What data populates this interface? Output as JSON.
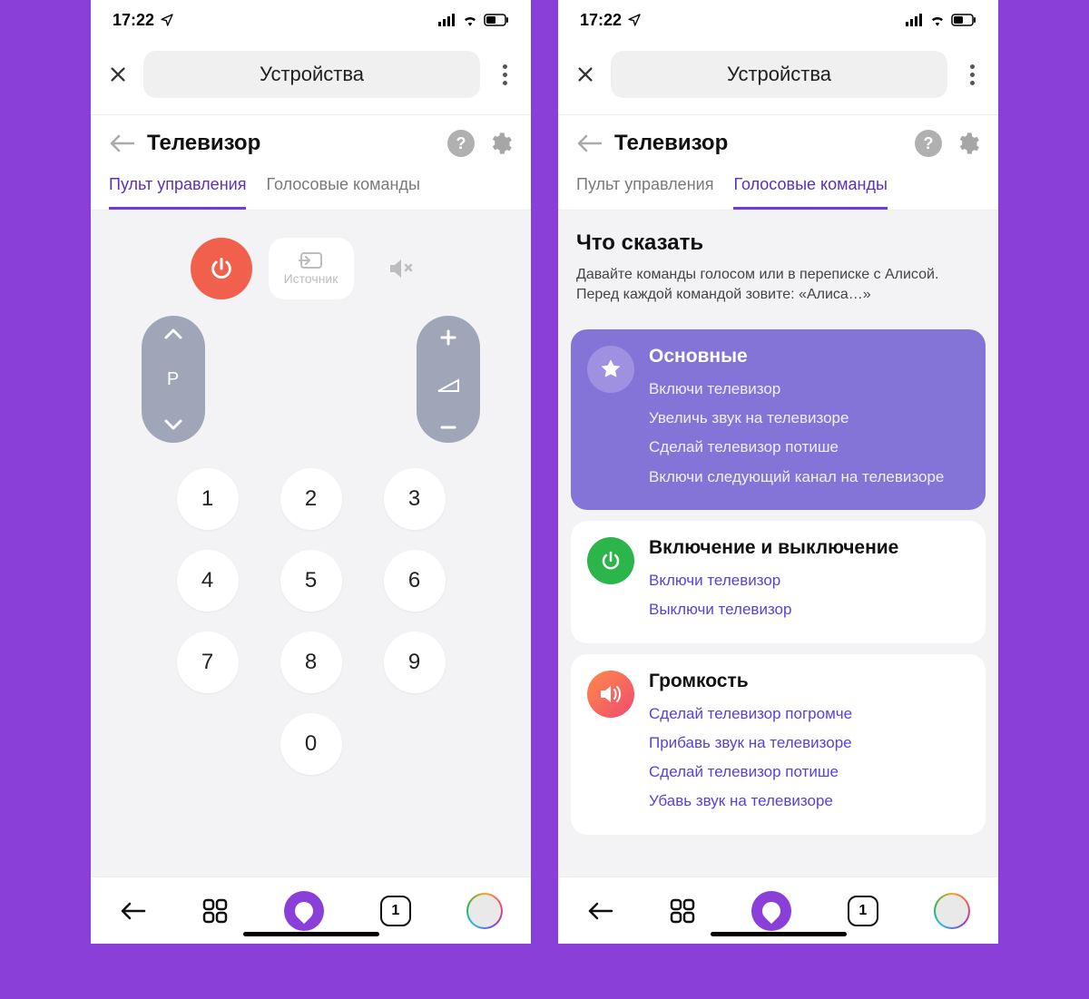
{
  "status": {
    "time": "17:22"
  },
  "header": {
    "pill": "Устройства"
  },
  "page": {
    "title": "Телевизор",
    "tabs": [
      "Пульт управления",
      "Голосовые команды"
    ]
  },
  "remote": {
    "source_label": "Источник",
    "channel_label": "P",
    "numpad": [
      "1",
      "2",
      "3",
      "4",
      "5",
      "6",
      "7",
      "8",
      "9",
      "0"
    ]
  },
  "voice": {
    "heading": "Что сказать",
    "subtitle": "Давайте команды голосом или в переписке с Алисой. Перед каждой командой зовите: «Алиса…»",
    "groups": [
      {
        "title": "Основные",
        "commands": [
          "Включи телевизор",
          "Увеличь звук на телевизоре",
          "Сделай телевизор потише",
          "Включи следующий канал на телевизоре"
        ]
      },
      {
        "title": "Включение и выключение",
        "commands": [
          "Включи телевизор",
          "Выключи телевизор"
        ]
      },
      {
        "title": "Громкость",
        "commands": [
          "Сделай телевизор погромче",
          "Прибавь звук на телевизоре",
          "Сделай телевизор потише",
          "Убавь звук на телевизоре"
        ]
      }
    ]
  },
  "bottomnav": {
    "tab_count": "1"
  }
}
